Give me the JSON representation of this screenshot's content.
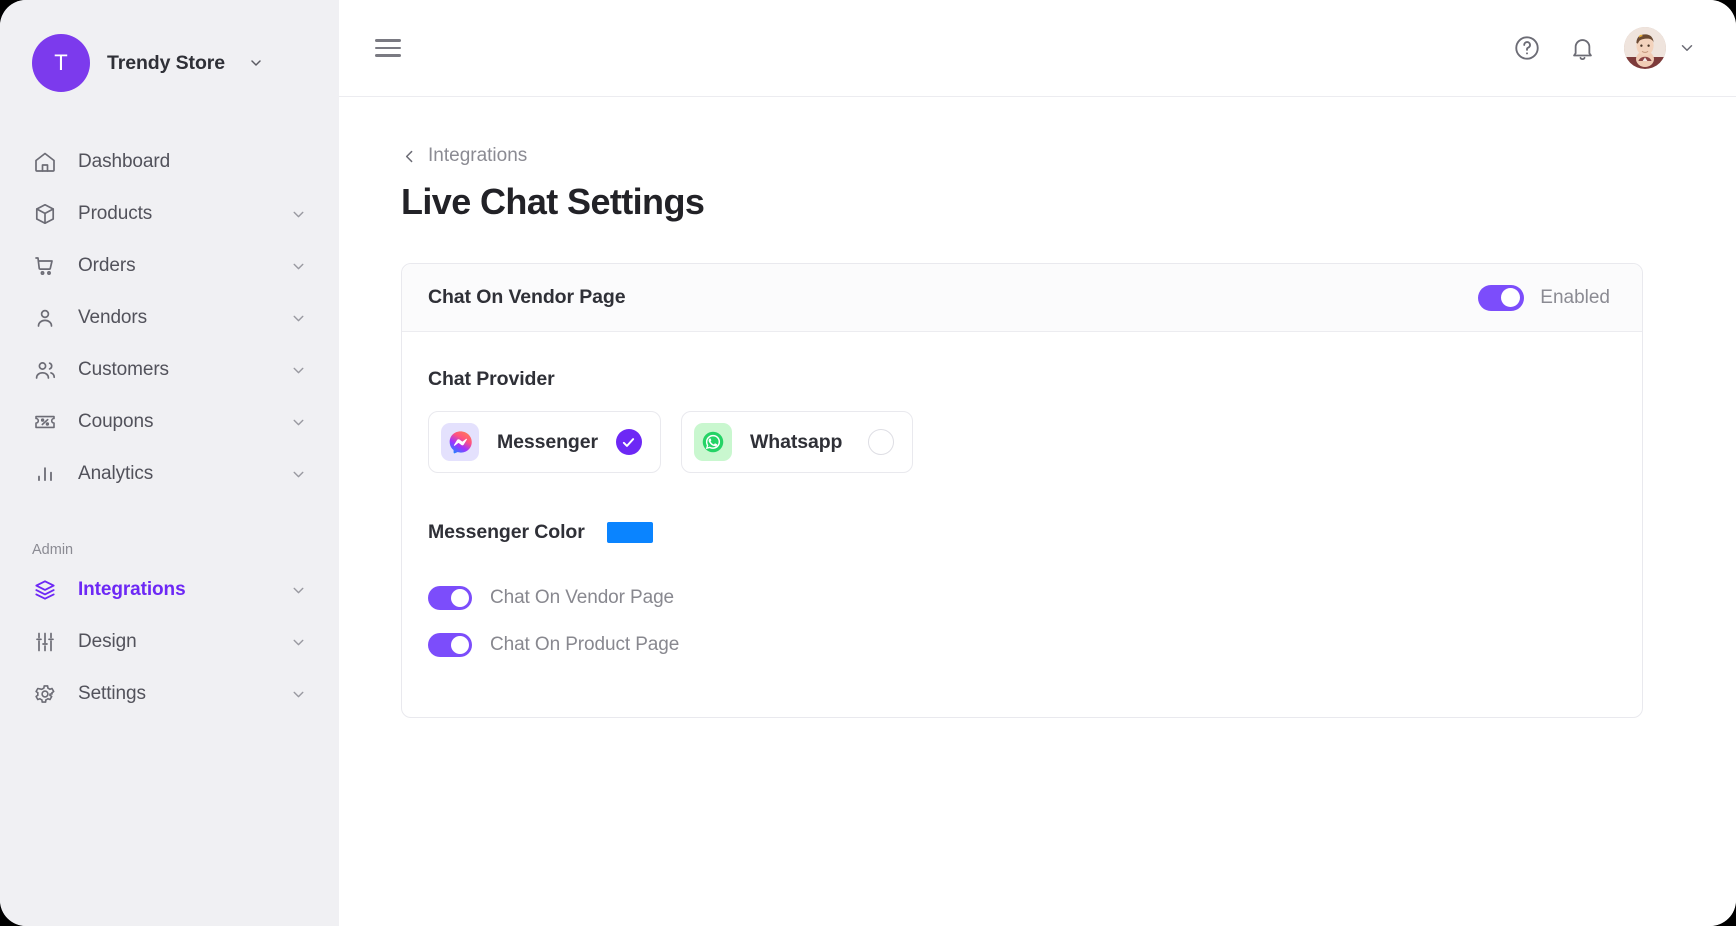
{
  "brand": {
    "initial": "T",
    "name": "Trendy Store",
    "caret_icon": "chevron-down-icon",
    "avatar_color": "#7c3aed"
  },
  "sidebar": {
    "items": [
      {
        "label": "Dashboard",
        "icon": "home-icon",
        "expandable": false,
        "active": false
      },
      {
        "label": "Products",
        "icon": "box-icon",
        "expandable": true,
        "active": false
      },
      {
        "label": "Orders",
        "icon": "cart-icon",
        "expandable": true,
        "active": false
      },
      {
        "label": "Vendors",
        "icon": "user-icon",
        "expandable": true,
        "active": false
      },
      {
        "label": "Customers",
        "icon": "users-icon",
        "expandable": true,
        "active": false
      },
      {
        "label": "Coupons",
        "icon": "ticket-percent-icon",
        "expandable": true,
        "active": false
      },
      {
        "label": "Analytics",
        "icon": "bar-chart-icon",
        "expandable": true,
        "active": false
      }
    ],
    "admin_section": {
      "title": "Admin",
      "items": [
        {
          "label": "Integrations",
          "icon": "layers-icon",
          "expandable": true,
          "active": true
        },
        {
          "label": "Design",
          "icon": "sliders-icon",
          "expandable": true,
          "active": false
        },
        {
          "label": "Settings",
          "icon": "gear-icon",
          "expandable": true,
          "active": false
        }
      ]
    },
    "active_color": "#6d28f5"
  },
  "topbar": {
    "menu_icon": "hamburger-icon",
    "help_icon": "help-circle-icon",
    "notifications_icon": "bell-icon",
    "avatar": "user-avatar-photo",
    "user_caret_icon": "chevron-down-icon"
  },
  "content": {
    "breadcrumb": {
      "back_icon": "chevron-left-icon",
      "label": "Integrations"
    },
    "page_title": "Live Chat Settings"
  },
  "card": {
    "header": {
      "title": "Chat On Vendor Page",
      "toggle_on": true,
      "toggle_label": "Enabled"
    },
    "chat_provider": {
      "label": "Chat Provider",
      "options": [
        {
          "name": "Messenger",
          "icon": "messenger-icon",
          "selected": true,
          "tile_color": "#e4e1fd"
        },
        {
          "name": "Whatsapp",
          "icon": "whatsapp-icon",
          "selected": false,
          "tile_color": "#c9f7cf"
        }
      ]
    },
    "messenger_color": {
      "label": "Messenger Color",
      "value": "#0a84ff"
    },
    "toggles": [
      {
        "label": "Chat On Vendor Page",
        "on": true
      },
      {
        "label": "Chat On Product Page",
        "on": true
      }
    ]
  }
}
